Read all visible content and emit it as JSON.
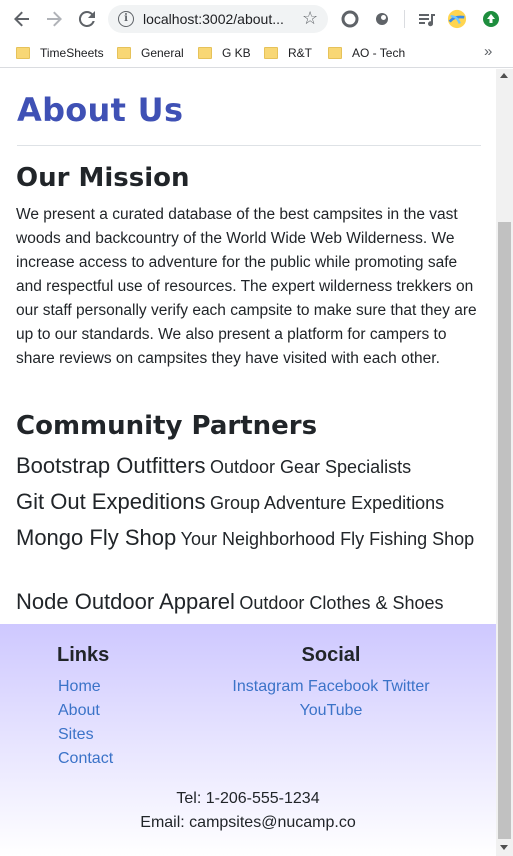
{
  "browser": {
    "url": "localhost:3002/about...",
    "bookmarks": [
      "TimeSheets",
      "General",
      "G KB",
      "R&T",
      "AO - Tech"
    ],
    "more_bookmarks": "»"
  },
  "page": {
    "title": "About Us",
    "mission": {
      "heading": "Our Mission",
      "text": "We present a curated database of the best campsites in the vast woods and backcountry of the World Wide Web Wilderness. We increase access to adventure for the public while promoting safe and respectful use of resources. The expert wilderness trekkers on our staff personally verify each campsite to make sure that they are up to our standards. We also present a platform for campers to share reviews on campsites they have visited with each other."
    },
    "partners": {
      "heading": "Community Partners",
      "items": [
        {
          "name": "Bootstrap Outfitters",
          "desc": "Outdoor Gear Specialists"
        },
        {
          "name": "Git Out Expeditions",
          "desc": "Group Adventure Expeditions"
        },
        {
          "name": "Mongo Fly Shop",
          "desc": "Your Neighborhood Fly Fishing Shop"
        },
        {
          "name": "Node Outdoor Apparel",
          "desc": "Outdoor Clothes & Shoes"
        }
      ]
    }
  },
  "footer": {
    "links_heading": "Links",
    "links": [
      "Home",
      "About",
      "Sites",
      "Contact"
    ],
    "social_heading": "Social",
    "social": [
      "Instagram",
      "Facebook",
      "Twitter",
      "YouTube"
    ],
    "tel": "Tel: 1-206-555-1234",
    "email": "Email: campsites@nucamp.co"
  },
  "colors": {
    "title_blue": "#3f51b5",
    "link_blue": "#3b73c8",
    "footer_top": "#cec8ff"
  }
}
